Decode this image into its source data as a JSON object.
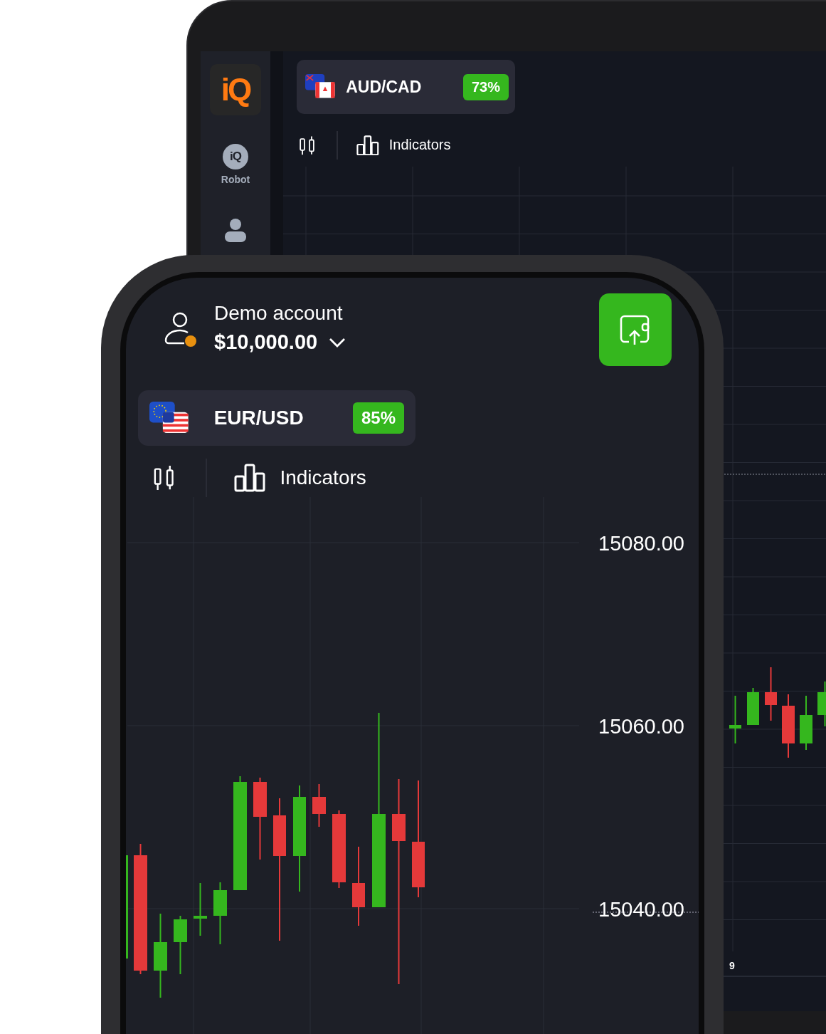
{
  "tablet": {
    "sidebar": {
      "logo": "iQ",
      "items": [
        {
          "kind": "robot",
          "label": "Robot",
          "icon_text": "iQ"
        },
        {
          "kind": "profile"
        }
      ]
    },
    "asset": {
      "pair": "AUD/CAD",
      "payout": "73%"
    },
    "toolbar": {
      "indicators_label": "Indicators"
    },
    "chart": {
      "time_label": "9"
    }
  },
  "phone": {
    "account": {
      "title": "Demo account",
      "balance": "$10,000.00"
    },
    "asset": {
      "pair": "EUR/USD",
      "payout": "85%"
    },
    "toolbar": {
      "indicators_label": "Indicators"
    },
    "chart": {
      "price_labels": [
        "15080.00",
        "15060.00",
        "15040.00"
      ]
    }
  }
}
